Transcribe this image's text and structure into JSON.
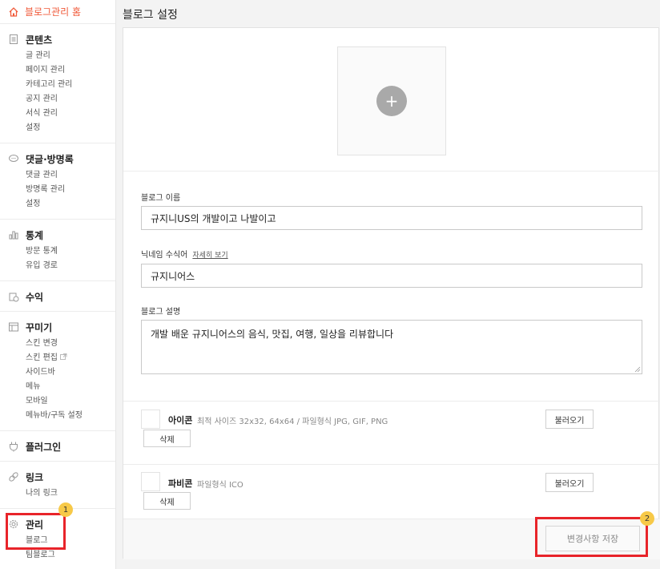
{
  "sidebar": {
    "home": "블로그관리 홈",
    "groups": [
      {
        "title": "콘텐츠",
        "icon": "document-icon",
        "items": [
          "글 관리",
          "페이지 관리",
          "카테고리 관리",
          "공지 관리",
          "서식 관리",
          "설정"
        ]
      },
      {
        "title": "댓글·방명록",
        "icon": "speech-bubble-icon",
        "items": [
          "댓글 관리",
          "방명록 관리",
          "설정"
        ]
      },
      {
        "title": "통계",
        "icon": "bar-chart-icon",
        "items": [
          "방문 통계",
          "유입 경로"
        ]
      },
      {
        "title": "수익",
        "icon": "coin-icon",
        "items": []
      },
      {
        "title": "꾸미기",
        "icon": "layout-icon",
        "items": [
          "스킨 변경",
          "스킨 편집",
          "사이드바",
          "메뉴",
          "모바일",
          "메뉴바/구독 설정"
        ]
      },
      {
        "title": "플러그인",
        "icon": "plug-icon",
        "items": []
      },
      {
        "title": "링크",
        "icon": "link-icon",
        "items": [
          "나의 링크"
        ]
      },
      {
        "title": "관리",
        "icon": "gear-icon",
        "items": [
          "블로그",
          "팀블로그"
        ]
      }
    ]
  },
  "main": {
    "title": "블로그 설정",
    "blog_name_label": "블로그 이름",
    "blog_name_value": "규지니US의 개발이고 나발이고",
    "nickname_label": "닉네임 수식어",
    "nickname_link": "자세히 보기",
    "nickname_value": "규지니어스",
    "desc_label": "블로그 설명",
    "desc_value": "개발 배운 규지니어스의 음식, 맛집, 여행, 일상을 리뷰합니다",
    "icon_title": "아이콘",
    "icon_desc": "최적 사이즈 32x32, 64x64 / 파일형식 JPG, GIF, PNG",
    "favicon_title": "파비콘",
    "favicon_desc": "파일형식 ICO",
    "load_label": "불러오기",
    "delete_label": "삭제",
    "save_label": "변경사항 저장"
  },
  "annotations": {
    "badge1": "1",
    "badge2": "2",
    "color": "#e8242a"
  }
}
